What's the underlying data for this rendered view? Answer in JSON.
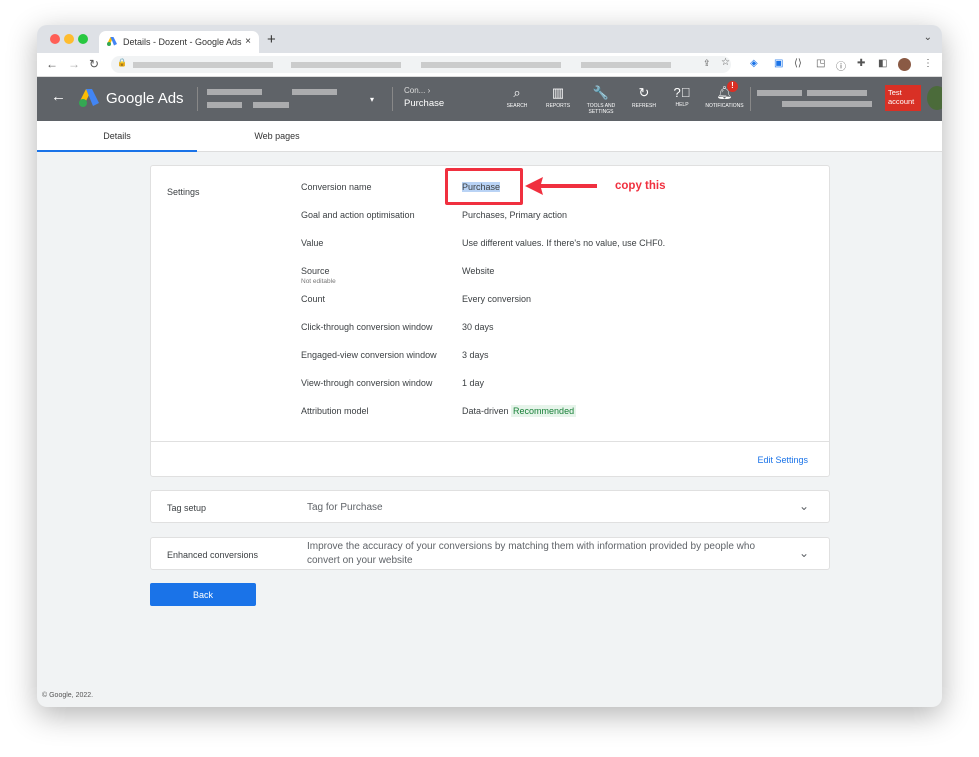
{
  "browser": {
    "tab_title": "Details - Dozent - Google Ads",
    "close": "×",
    "new_tab": "+"
  },
  "header": {
    "brand": "Google Ads",
    "breadcrumb_parent": "Con...",
    "breadcrumb_current": "Purchase",
    "tools": [
      {
        "label": "SEARCH",
        "icon": "search-icon"
      },
      {
        "label": "REPORTS",
        "icon": "reports-icon"
      },
      {
        "label": "TOOLS AND SETTINGS",
        "icon": "wrench-icon"
      },
      {
        "label": "REFRESH",
        "icon": "refresh-icon"
      },
      {
        "label": "HELP",
        "icon": "help-icon"
      },
      {
        "label": "NOTIFICATIONS",
        "icon": "bell-icon"
      }
    ],
    "notification_badge": "!",
    "test_account": "Test account"
  },
  "tabs": [
    {
      "label": "Details",
      "active": true
    },
    {
      "label": "Web pages",
      "active": false
    }
  ],
  "settings": {
    "section": "Settings",
    "rows": [
      {
        "label": "Conversion name",
        "value": "Purchase"
      },
      {
        "label": "Goal and action optimisation",
        "value": "Purchases, Primary action"
      },
      {
        "label": "Value",
        "value": "Use different values. If there's no value, use CHF0."
      },
      {
        "label": "Source",
        "sublabel": "Not editable",
        "value": "Website"
      },
      {
        "label": "Count",
        "value": "Every conversion"
      },
      {
        "label": "Click-through conversion window",
        "value": "30 days"
      },
      {
        "label": "Engaged-view conversion window",
        "value": "3 days"
      },
      {
        "label": "View-through conversion window",
        "value": "1 day"
      },
      {
        "label": "Attribution model",
        "value": "Data-driven",
        "badge": "Recommended"
      }
    ],
    "edit": "Edit Settings"
  },
  "annotation": {
    "text": "copy this",
    "color": "#f0303f"
  },
  "tag_setup": {
    "title": "Tag setup",
    "desc": "Tag for Purchase"
  },
  "enhanced": {
    "title": "Enhanced conversions",
    "desc": "Improve the accuracy of your conversions by matching them with information provided by people who convert on your website"
  },
  "back": "Back",
  "footer": "© Google, 2022."
}
